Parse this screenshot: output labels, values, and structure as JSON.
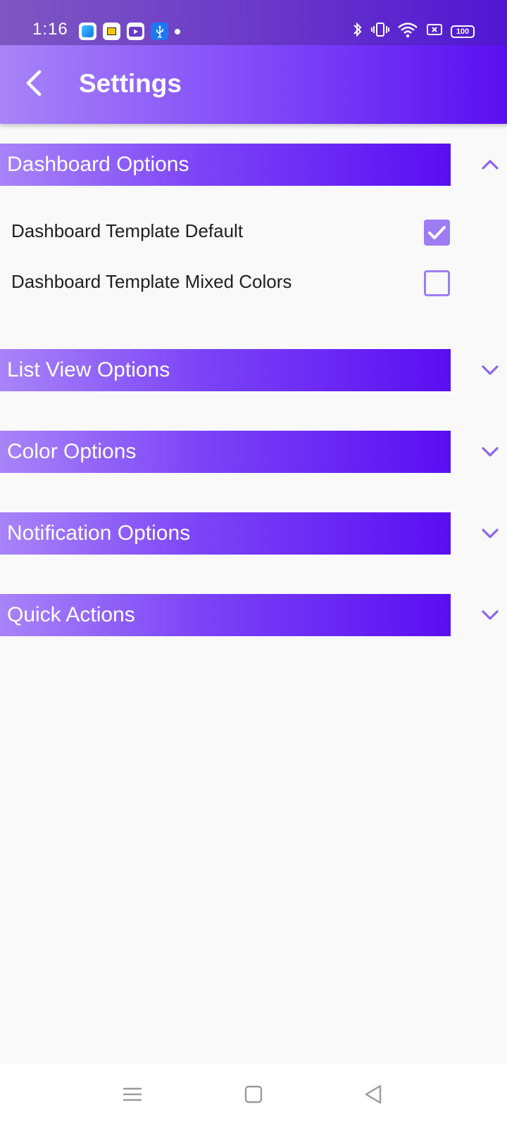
{
  "status_bar": {
    "time": "1:16",
    "battery": "100",
    "app_icons": [
      "generic-app-icon",
      "yellow-app-icon",
      "youtube-icon",
      "usb-icon"
    ],
    "system_icons": [
      "bluetooth-icon",
      "vibrate-icon",
      "wifi-icon",
      "no-sim-icon",
      "battery-icon"
    ]
  },
  "app_bar": {
    "title": "Settings",
    "back_icon": "chevron-left-icon"
  },
  "sections": [
    {
      "title": "Dashboard Options",
      "expanded": true,
      "options": [
        {
          "label": "Dashboard Template Default",
          "checked": true
        },
        {
          "label": "Dashboard Template Mixed Colors",
          "checked": false
        }
      ]
    },
    {
      "title": "List View Options",
      "expanded": false
    },
    {
      "title": "Color Options",
      "expanded": false
    },
    {
      "title": "Notification Options",
      "expanded": false
    },
    {
      "title": "Quick Actions",
      "expanded": false
    }
  ],
  "nav_bar": {
    "icons": [
      "menu-icon",
      "home-square-icon",
      "back-triangle-icon"
    ]
  },
  "colors": {
    "status_bar": "#6a3ac9",
    "accent_light": "#a884f8",
    "accent_dark": "#5a0ff0",
    "checkbox": "#9e7cf3",
    "chevron": "#8e63f2",
    "background": "#f9f9f9"
  }
}
